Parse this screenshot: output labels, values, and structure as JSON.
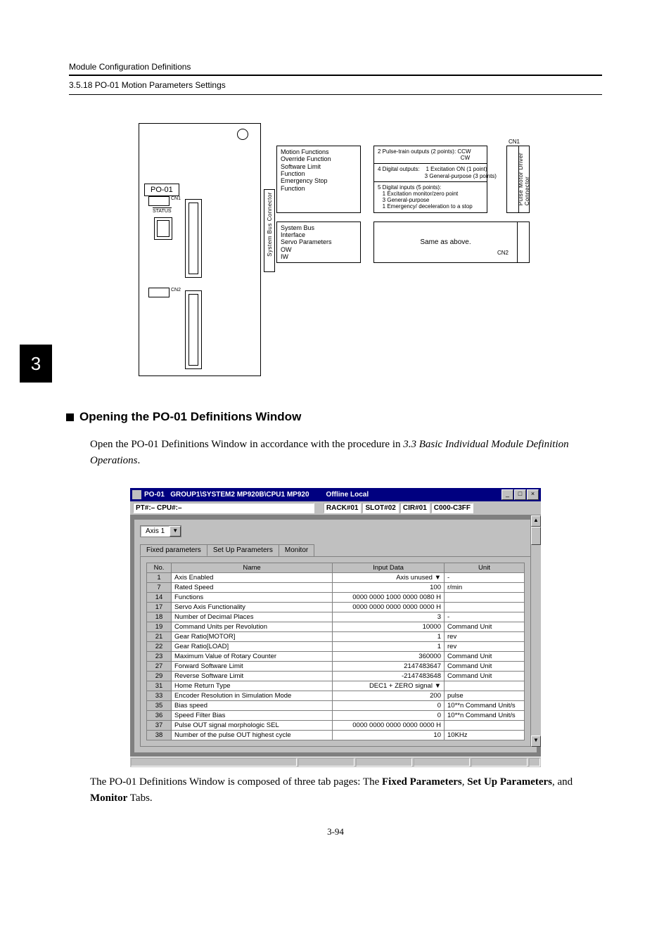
{
  "running_head": "Module Configuration Definitions",
  "subhead": "3.5.18  PO-01 Motion Parameters Settings",
  "chapter_tab": "3",
  "diagram": {
    "module_label": "PO-01",
    "status_label": "STATUS",
    "cn1_small": "CN1",
    "cn2_small": "CN2",
    "sysbus_conn": "System Bus Connector",
    "left_text": "Motion Functions\nOverride Function\nSoftware Limit\nFunction\nEmergency Stop\nFunction",
    "left_text2": "System Bus\nInterface\nServo Parameters\nOW\nIW",
    "rt1": "2 Pulse-train outputs (2 points): CCW\n                                                     CW",
    "rt2": "4 Digital outputs:    1 Excitation ON (1 point)\n                              3 General-purpose (3 points)",
    "rt3": "5 Digital inputs (5 points):\n   1 Excitation monitor/zero point\n   3 General-purpose\n   1 Emergency/ deceleration to a stop",
    "rt4": "Same as above.",
    "cn1": "CN1",
    "cn2": "CN2",
    "pmd": "Pulse Motor Driver\nConnector"
  },
  "section_heading": "Opening the PO-01 Definitions Window",
  "body1_a": "Open the PO-01 Definitions Window in accordance with the procedure in ",
  "body1_i": "3.3 Basic Individual Module Definition Operations",
  "body1_b": ".",
  "screenshot": {
    "title_app": "PO-01",
    "title_path": "GROUP1\\SYSTEM2  MP920B\\CPU1  MP920",
    "title_mode": "Offline  Local",
    "info_left": "PT#:–  CPU#:–",
    "info_r1": "RACK#01",
    "info_r2": "SLOT#02",
    "info_r3": "CIR#01",
    "info_r4": "C000-C3FF",
    "axis_dd": "Axis 1",
    "tab1": "Fixed parameters",
    "tab2": "Set Up Parameters",
    "tab3": "Monitor",
    "cols": {
      "no": "No.",
      "name": "Name",
      "input": "Input Data",
      "unit": "Unit"
    },
    "rows": [
      {
        "no": "1",
        "name": "Axis Enabled",
        "input": "Axis unused ▼",
        "unit": "-"
      },
      {
        "no": "7",
        "name": "Rated Speed",
        "input": "100",
        "unit": "r/min"
      },
      {
        "no": "14",
        "name": "Functions",
        "input": "0000 0000 1000 0000 0080 H",
        "unit": ""
      },
      {
        "no": "17",
        "name": "Servo Axis Functionality",
        "input": "0000 0000 0000 0000 0000 H",
        "unit": ""
      },
      {
        "no": "18",
        "name": "Number of Decimal Places",
        "input": "3",
        "unit": "-"
      },
      {
        "no": "19",
        "name": "Command Units per Revolution",
        "input": "10000",
        "unit": "Command Unit"
      },
      {
        "no": "21",
        "name": "Gear Ratio[MOTOR]",
        "input": "1",
        "unit": "rev"
      },
      {
        "no": "22",
        "name": "Gear Ratio[LOAD]",
        "input": "1",
        "unit": "rev"
      },
      {
        "no": "23",
        "name": "Maximum Value of Rotary Counter",
        "input": "360000",
        "unit": "Command Unit"
      },
      {
        "no": "27",
        "name": "Forward Software Limit",
        "input": "2147483647",
        "unit": "Command Unit"
      },
      {
        "no": "29",
        "name": "Reverse Software Limit",
        "input": "-2147483648",
        "unit": "Command Unit"
      },
      {
        "no": "31",
        "name": "Home Return Type",
        "input": "DEC1 + ZERO signal ▼",
        "unit": ""
      },
      {
        "no": "33",
        "name": "Encoder Resolution in Simulation Mode",
        "input": "200",
        "unit": "pulse"
      },
      {
        "no": "35",
        "name": "Bias speed",
        "input": "0",
        "unit": "10**n Command Unit/s"
      },
      {
        "no": "36",
        "name": "Speed Filter Bias",
        "input": "0",
        "unit": "10**n Command Unit/s"
      },
      {
        "no": "37",
        "name": "Pulse OUT signal morphologic SEL",
        "input": "0000 0000 0000 0000 0000 H",
        "unit": ""
      },
      {
        "no": "38",
        "name": "Number of the pulse OUT highest cycle",
        "input": "10",
        "unit": "10KHz"
      }
    ]
  },
  "body2_a": "The PO-01 Definitions Window is composed of three tab pages: The ",
  "body2_b1": "Fixed Parameters",
  "body2_c": ", ",
  "body2_b2": "Set Up Parameters",
  "body2_d": ", and ",
  "body2_b3": "Monitor",
  "body2_e": " Tabs.",
  "page_no": "3-94"
}
